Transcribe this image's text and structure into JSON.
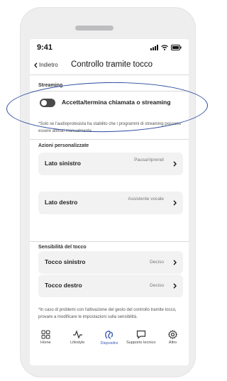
{
  "status_bar": {
    "time": "9:41"
  },
  "nav": {
    "back_label": "Indietro",
    "title": "Controllo tramite tocco"
  },
  "streaming": {
    "section_label": "Streaming",
    "toggle_label": "Accetta/termina chiamata o streaming",
    "toggle_on": false,
    "note": "*Solo se l'audioprotesista ha stabilito che i programmi di streaming possono essere attivati manualmente."
  },
  "custom_actions": {
    "section_label": "Azioni personalizzate",
    "items": [
      {
        "label": "Lato sinistro",
        "value": "Pausa/riprendi"
      },
      {
        "label": "Lato destro",
        "value": "Assistente vocale"
      }
    ]
  },
  "sensitivity": {
    "section_label": "Sensibilità del tocco",
    "items": [
      {
        "label": "Tocco sinistro",
        "value": "Deciso"
      },
      {
        "label": "Tocco destro",
        "value": "Deciso"
      }
    ],
    "note": "*In caso di problemi con l'attivazione del gesto del controllo tramite tocco, provare a modificare le impostazioni sulla sensibilità."
  },
  "tab_bar": {
    "items": [
      {
        "label": "Home",
        "icon": "grid-icon"
      },
      {
        "label": "Lifestyle",
        "icon": "activity-icon"
      },
      {
        "label": "Dispositivi",
        "icon": "hearing-aid-icon",
        "active": true
      },
      {
        "label": "Supporto tecnico",
        "icon": "chat-icon"
      },
      {
        "label": "Altro",
        "icon": "gear-icon"
      }
    ]
  },
  "colors": {
    "accent": "#3b5bb5",
    "annotation_outline": "#2a4a9c"
  }
}
